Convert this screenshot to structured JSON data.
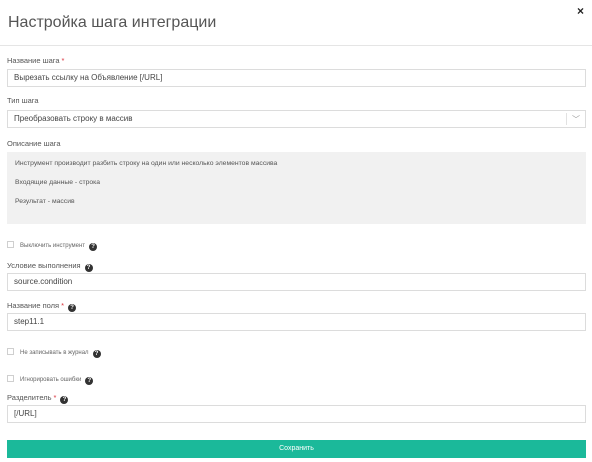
{
  "dialog": {
    "title": "Настройка шага интеграции",
    "close_icon": "×"
  },
  "step_name": {
    "label": "Название шага",
    "required_mark": "*",
    "value": "Вырезать ссылку на Объявление [/URL]"
  },
  "step_type": {
    "label": "Тип шага",
    "value": "Преобразовать строку в массив",
    "chevron_icon": "﹀"
  },
  "step_description": {
    "label": "Описание шага",
    "lines": [
      "Инструмент производит разбить строку на один или несколько элементов массива",
      "Входящие данные - строка",
      "Результат - массив"
    ]
  },
  "disable_tool": {
    "label": "Выключить инструмент",
    "checked": false,
    "help_icon": "?"
  },
  "condition": {
    "label": "Условие выполнения",
    "help_icon": "?",
    "value": "source.condition"
  },
  "field_name": {
    "label": "Название поля",
    "required_mark": "*",
    "help_icon": "?",
    "value": "step11.1"
  },
  "no_log": {
    "label": "Не записывать в журнал",
    "checked": false,
    "help_icon": "?"
  },
  "ignore_errors": {
    "label": "Игнорировать ошибки",
    "checked": false,
    "help_icon": "?"
  },
  "separator": {
    "label": "Разделитель",
    "required_mark": "*",
    "help_icon": "?",
    "value": "[/URL]"
  },
  "actions": {
    "save_label": "Сохранить"
  },
  "colors": {
    "accent": "#1bb99a",
    "required": "#d9303a",
    "description_bg": "#f1f1f1"
  }
}
